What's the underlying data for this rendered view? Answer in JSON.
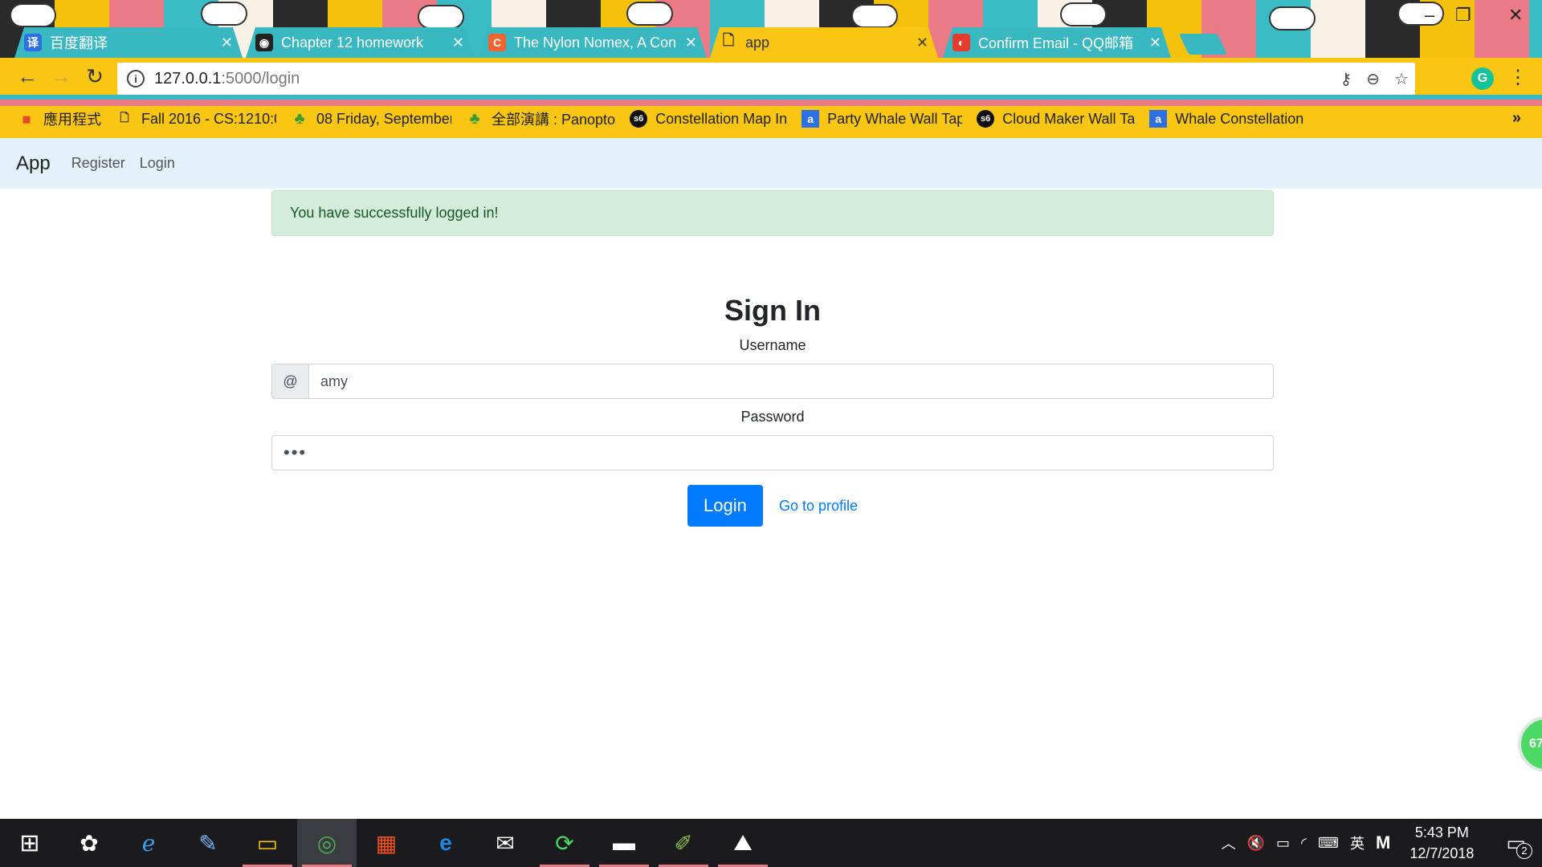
{
  "browser": {
    "tabs": [
      {
        "title": "百度翻译",
        "favicon": "baidu-translate-icon",
        "favicon_text": "译",
        "favicon_color": "#2f6fe4"
      },
      {
        "title": "Chapter 12 homework",
        "favicon": "canvas-icon",
        "favicon_text": "◉",
        "favicon_color": "#222222"
      },
      {
        "title": "The Nylon Nomex, A Con",
        "favicon": "c-site-icon",
        "favicon_text": "C",
        "favicon_color": "#f0652f"
      },
      {
        "title": "app",
        "favicon": "page-icon",
        "favicon_text": "🗋",
        "favicon_color": "#f9c613"
      },
      {
        "title": "Confirm Email - QQ邮箱",
        "favicon": "qq-mail-icon",
        "favicon_text": "◐",
        "favicon_color": "#e33b2e"
      }
    ],
    "active_tab_index": 3,
    "url_host": "127.0.0.1",
    "url_path": ":5000/login",
    "bookmarks": [
      {
        "label": "應用程式",
        "icon": "apps-grid-icon",
        "icon_text": "⋮⋮⋮"
      },
      {
        "label": "Fall 2016 - CS:1210:0",
        "icon": "page-icon",
        "icon_text": "🗋"
      },
      {
        "label": "08 Friday, September",
        "icon": "panopto-icon",
        "icon_text": "♣"
      },
      {
        "label": "全部演講 : Panopto",
        "icon": "panopto-icon",
        "icon_text": "♣"
      },
      {
        "label": "Constellation Map In",
        "icon": "s6-icon",
        "icon_text": "s6"
      },
      {
        "label": "Party Whale Wall Tap",
        "icon": "a-site-icon",
        "icon_text": "a"
      },
      {
        "label": "Cloud Maker Wall Ta",
        "icon": "s6-icon",
        "icon_text": "s6"
      },
      {
        "label": "Whale Constellation",
        "icon": "a-site-icon",
        "icon_text": "a"
      }
    ],
    "bookmarks_overflow": "»"
  },
  "app": {
    "brand": "App",
    "nav": {
      "register": "Register",
      "login": "Login"
    },
    "flash": "You have successfully logged in!",
    "heading": "Sign In",
    "username_label": "Username",
    "username_prepend": "@",
    "username_value": "amy",
    "password_label": "Password",
    "password_value": "•••",
    "login_button": "Login",
    "profile_link": "Go to profile",
    "floating_badge": "67"
  },
  "taskbar": {
    "items": [
      {
        "name": "start-button",
        "glyph": "⊞"
      },
      {
        "name": "pinwheel-app",
        "glyph": "✿"
      },
      {
        "name": "internet-explorer",
        "glyph": "ℯ"
      },
      {
        "name": "pen-app",
        "glyph": "✎"
      },
      {
        "name": "file-explorer",
        "glyph": "▭"
      },
      {
        "name": "chrome",
        "glyph": "◎"
      },
      {
        "name": "microsoft-store",
        "glyph": "▦"
      },
      {
        "name": "edge",
        "glyph": "e"
      },
      {
        "name": "mail",
        "glyph": "✉"
      },
      {
        "name": "refresh-app",
        "glyph": "⟳"
      },
      {
        "name": "command-prompt",
        "glyph": "▬"
      },
      {
        "name": "notepad-app",
        "glyph": "✐"
      },
      {
        "name": "photos",
        "glyph": "⛰"
      }
    ],
    "active_index": 5,
    "ime": "英",
    "ime_mode": "M",
    "time": "5:43 PM",
    "date": "12/7/2018",
    "notification_count": "2"
  }
}
